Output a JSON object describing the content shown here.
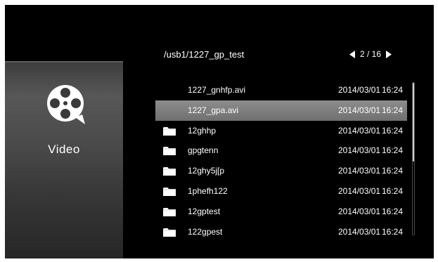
{
  "app": {
    "label": "Video",
    "icon": "film-reel-icon"
  },
  "header": {
    "path": "/usb1/1227_gp_test"
  },
  "pager": {
    "prev_icon": "triangle-left-icon",
    "text": "2 / 16",
    "next_icon": "triangle-right-icon",
    "current_page": 2,
    "total_pages": 16
  },
  "files": [
    {
      "type": "file",
      "name": "1227_gnhfp.avi",
      "date": "2014/03/01",
      "time": "16:24",
      "selected": false
    },
    {
      "type": "file",
      "name": "1227_gpa.avi",
      "date": "2014/03/01",
      "time": "16:24",
      "selected": true
    },
    {
      "type": "folder",
      "name": "12ghhp",
      "date": "2014/03/01",
      "time": "16:24",
      "selected": false
    },
    {
      "type": "folder",
      "name": "gpgtenn",
      "date": "2014/03/01",
      "time": "16:24",
      "selected": false
    },
    {
      "type": "folder",
      "name": "12ghy5j[p",
      "date": "2014/03/01",
      "time": "16:24",
      "selected": false
    },
    {
      "type": "folder",
      "name": "1phefh122",
      "date": "2014/03/01",
      "time": "16:24",
      "selected": false
    },
    {
      "type": "folder",
      "name": "12gptest",
      "date": "2014/03/01",
      "time": "16:24",
      "selected": false
    },
    {
      "type": "folder",
      "name": "122gpest",
      "date": "2014/03/01",
      "time": "16:24",
      "selected": false
    }
  ],
  "colors": {
    "background": "#000000",
    "text": "#ffffff",
    "selection": "#7f7f7f",
    "folder": "#ffffff"
  }
}
